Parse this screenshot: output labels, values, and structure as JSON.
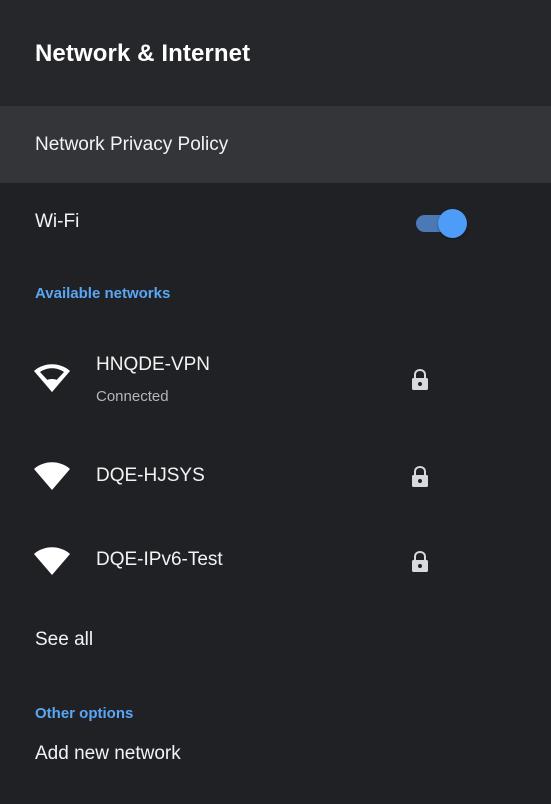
{
  "header": {
    "title": "Network & Internet"
  },
  "privacy": {
    "label": "Network Privacy Policy"
  },
  "wifi": {
    "label": "Wi-Fi",
    "enabled": true,
    "accent": "#4d9cf8"
  },
  "available": {
    "header": "Available networks",
    "networks": [
      {
        "name": "HNQDE-VPN",
        "status": "Connected",
        "icon": "wifi-icon",
        "secured": true
      },
      {
        "name": "DQE-HJSYS",
        "icon": "wifi-icon",
        "secured": true
      },
      {
        "name": "DQE-IPv6-Test",
        "icon": "wifi-icon",
        "secured": true
      }
    ],
    "see_all": "See all"
  },
  "other": {
    "header": "Other options",
    "add_network": "Add new network"
  },
  "colors": {
    "background": "#202124",
    "header_bg": "#26272a",
    "selected_bg": "#333538",
    "section_header": "#5aa6f5"
  }
}
